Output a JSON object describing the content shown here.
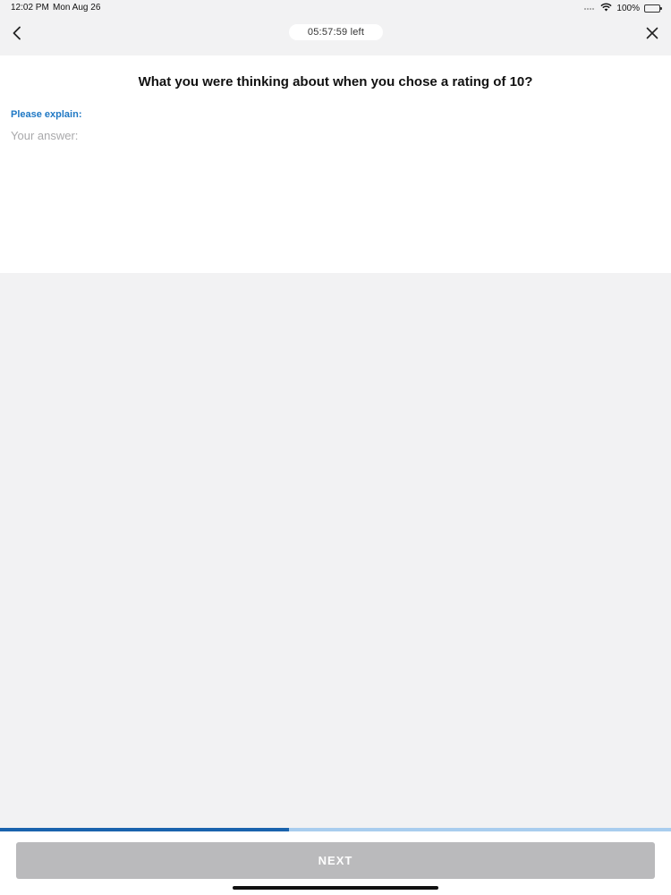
{
  "status_bar": {
    "time": "12:02 PM",
    "date": "Mon Aug 26",
    "battery_percent": "100%",
    "wifi_icon": "wifi-icon",
    "battery_icon": "battery-icon"
  },
  "nav": {
    "back_icon": "chevron-left-icon",
    "close_icon": "close-icon",
    "timer": "05:57:59 left"
  },
  "question": {
    "title": "What you were thinking about when you chose a rating of 10?",
    "explain_label": "Please explain:",
    "answer_placeholder": "Your answer:",
    "answer_value": ""
  },
  "progress": {
    "fraction": 0.43
  },
  "footer": {
    "next_label": "NEXT"
  },
  "colors": {
    "accent": "#1f78c4",
    "progress_fill": "#1a63ad",
    "progress_track": "#a9cdee",
    "next_disabled": "#bababc",
    "background": "#f2f2f3"
  }
}
